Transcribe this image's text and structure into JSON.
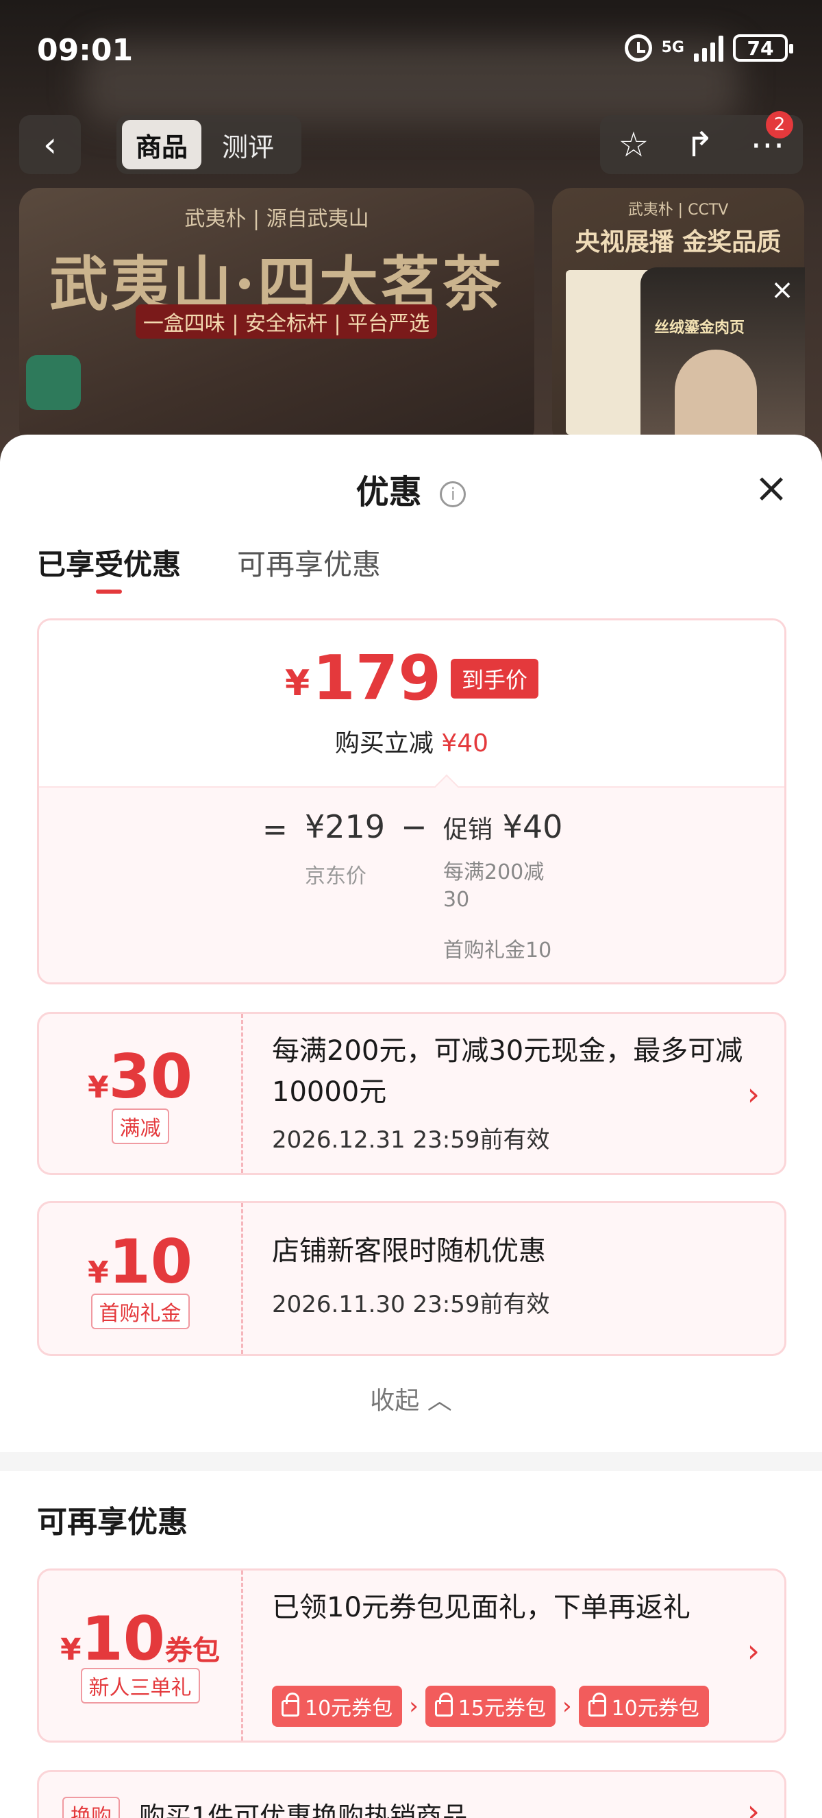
{
  "status_bar": {
    "time": "09:01",
    "network": "5G",
    "battery": "74"
  },
  "nav": {
    "back_icon": "chevron-left-icon",
    "tabs": [
      {
        "label": "商品"
      },
      {
        "label": "测评"
      }
    ],
    "actions": [
      "star-icon",
      "share-icon",
      "more-icon"
    ],
    "badge_count": "2"
  },
  "hero": {
    "brand": "武夷朴 | 源自武夷山",
    "title": "武夷山·四大茗茶",
    "tagline": "一盒四味 | 安全标杆 | 平台严选"
  },
  "hero2": {
    "brand": "武夷朴 | CCTV",
    "title": "央视展播 金奖品质",
    "video_title": "丝绒鎏金肉页"
  },
  "sheet": {
    "title": "优惠",
    "tabs": [
      {
        "label": "已享受优惠"
      },
      {
        "label": "可再享优惠"
      }
    ],
    "summary": {
      "currency": "¥",
      "final_price": "179",
      "final_tag": "到手价",
      "reduce_label": "购买立减",
      "reduce_amount": "¥40",
      "equals": "=",
      "original_price": "¥219",
      "original_label": "京东价",
      "minus": "−",
      "promo_label": "促销",
      "promo_amount": "¥40",
      "promo_detail_1": "每满200减30",
      "promo_detail_2": "首购礼金10"
    },
    "coupons": [
      {
        "currency": "¥",
        "amount": "30",
        "suffix": "",
        "badge": "满减",
        "desc": "每满200元，可减30元现金，最多可减10000元",
        "date": "2026.12.31 23:59前有效"
      },
      {
        "currency": "¥",
        "amount": "10",
        "suffix": "",
        "badge": "首购礼金",
        "desc": "店铺新客限时随机优惠",
        "date": "2026.11.30 23:59前有效"
      }
    ],
    "collapse_label": "收起 ︿",
    "more_section": {
      "title": "可再享优惠",
      "coupon": {
        "currency": "¥",
        "amount": "10",
        "suffix": "券包",
        "badge": "新人三单礼",
        "desc": "已领10元券包见面礼，下单再返礼",
        "chips": [
          "10元券包",
          "15元券包",
          "10元券包"
        ]
      },
      "partial": {
        "tag": "换购",
        "text": "购买1件可优惠换购热销商品"
      }
    }
  }
}
